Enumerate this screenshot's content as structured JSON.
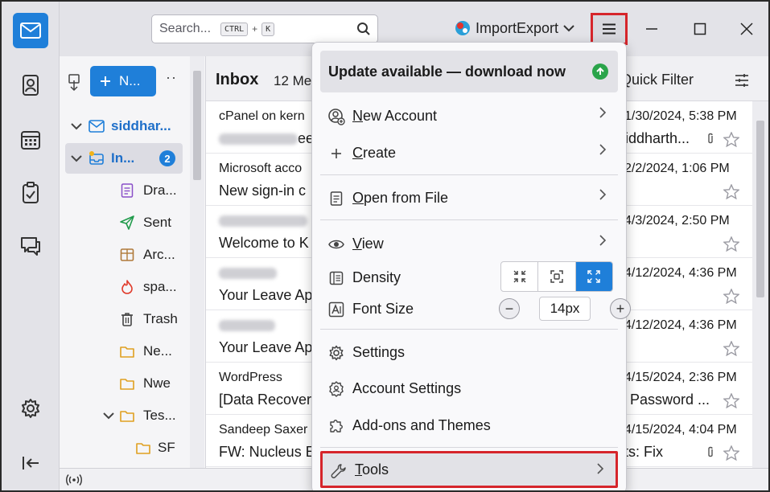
{
  "search": {
    "placeholder": "Search...",
    "shortcut_key1": "CTRL",
    "shortcut_plus": "+",
    "shortcut_key2": "K"
  },
  "account_button": {
    "label": "ImportExport"
  },
  "colors": {
    "accent": "#1f7fd9",
    "highlight_border": "#d6252b",
    "update_ok": "#2aa44a"
  },
  "folder_pane": {
    "new_message_label": "N...",
    "account_name": "siddhar...",
    "folders": [
      {
        "label": "In...",
        "icon": "inbox-icon",
        "badge": "2"
      },
      {
        "label": "Dra...",
        "icon": "drafts-icon"
      },
      {
        "label": "Sent",
        "icon": "sent-icon"
      },
      {
        "label": "Arc...",
        "icon": "archive-icon"
      },
      {
        "label": "spa...",
        "icon": "spam-icon"
      },
      {
        "label": "Trash",
        "icon": "trash-icon"
      },
      {
        "label": "Ne...",
        "icon": "folder-icon"
      },
      {
        "label": "Nwe",
        "icon": "folder-icon"
      },
      {
        "label": "Tes...",
        "icon": "folder-icon"
      },
      {
        "label": "SF",
        "icon": "folder-icon"
      }
    ]
  },
  "message_list": {
    "title": "Inbox",
    "count": "12 Me",
    "quick_filter": "Quick Filter",
    "messages": [
      {
        "from": "cPanel on kern",
        "subject": "ee",
        "date": "1/30/2024, 5:38 PM",
        "right_subject": "siddharth...",
        "attachment": true
      },
      {
        "from": "Microsoft acco",
        "subject": "New sign-in c",
        "date": "2/2/2024, 1:06 PM",
        "right_subject": "",
        "attachment": false
      },
      {
        "from": "",
        "subject": "Welcome to K",
        "date": "4/3/2024, 2:50 PM",
        "right_subject": "",
        "attachment": false
      },
      {
        "from": "",
        "subject": "Your Leave Ap",
        "date": "4/12/2024, 4:36 PM",
        "right_subject": "",
        "attachment": false
      },
      {
        "from": "",
        "subject": "Your Leave Ap",
        "date": "4/12/2024, 4:36 PM",
        "right_subject": "",
        "attachment": false
      },
      {
        "from": "WordPress",
        "subject": "[Data Recover",
        "date": "4/15/2024, 2:36 PM",
        "right_subject": "Password ...",
        "attachment": false
      },
      {
        "from": "Sandeep Saxer",
        "subject": "FW: Nucleus E",
        "date": "4/15/2024, 4:04 PM",
        "right_subject": "ts: Fix",
        "attachment": true
      }
    ]
  },
  "app_menu": {
    "update_banner": "Update available — download now",
    "new_account": {
      "u": "N",
      "rest": "ew Account"
    },
    "create": {
      "u": "C",
      "rest": "reate"
    },
    "open_from_file": {
      "u": "O",
      "rest": "pen from File"
    },
    "view": {
      "u": "V",
      "rest": "iew"
    },
    "density": "Density",
    "font_size": "Font Size",
    "font_size_value": "14px",
    "font_minus": "−",
    "font_plus": "+",
    "settings": "Settings",
    "account_settings": "Account Settings",
    "addons_themes": "Add-ons and Themes",
    "tools": {
      "u": "T",
      "rest": "ools"
    }
  }
}
